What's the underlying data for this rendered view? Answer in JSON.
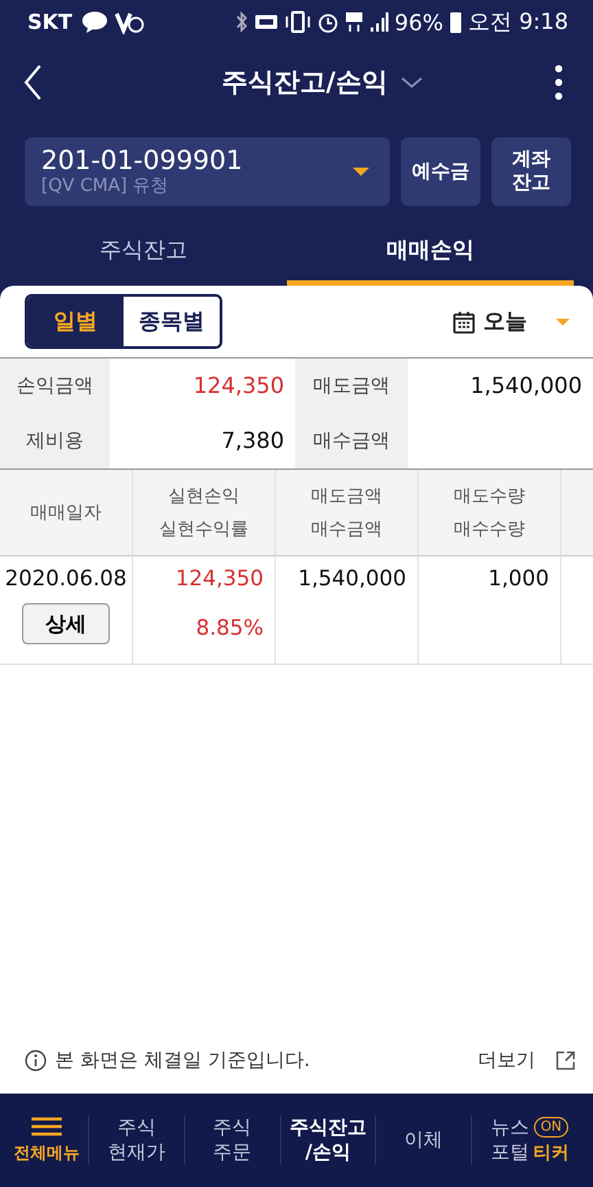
{
  "status_bar": {
    "carrier": "SKT",
    "battery": "96%",
    "time": "오전 9:18"
  },
  "header": {
    "title": "주식잔고/손익"
  },
  "account": {
    "number": "201-01-099901",
    "name": "[QV CMA] 유청",
    "buttons": [
      "예수금",
      "계좌\n잔고"
    ]
  },
  "tabs": [
    {
      "label": "주식잔고",
      "selected": false
    },
    {
      "label": "매매손익",
      "selected": true
    }
  ],
  "view_toggle": [
    {
      "label": "일별",
      "selected": true
    },
    {
      "label": "종목별",
      "selected": false
    }
  ],
  "period": {
    "value": "오늘"
  },
  "summary": [
    {
      "label": "손익금액",
      "value": "124,350",
      "gain": true
    },
    {
      "label": "매도금액",
      "value": "1,540,000",
      "gain": false
    },
    {
      "label": "제비용",
      "value": "7,380",
      "gain": false
    },
    {
      "label": "매수금액"
    }
  ],
  "table": {
    "columns": [
      [
        "매매일자"
      ],
      [
        "실현손익",
        "실현수익률"
      ],
      [
        "매도금액",
        "매수금액"
      ],
      [
        "매도수량",
        "매수수량"
      ]
    ],
    "rows": [
      {
        "date": "2020.06.08",
        "action": "상세",
        "realized": "124,350",
        "rate": "8.85%",
        "sell_amount": "1,540,000",
        "sell_qty": "1,000",
        "gain": true
      }
    ]
  },
  "footer": {
    "note": "본 화면은 체결일 기준입니다.",
    "more": "더보기"
  },
  "bottom_nav": [
    {
      "label": "전체메뉴",
      "kind": "menu",
      "selected": false
    },
    {
      "label": "주식\n현재가",
      "kind": "link",
      "selected": false
    },
    {
      "label": "주식\n주문",
      "kind": "link",
      "selected": false
    },
    {
      "label": "주식잔고\n/손익",
      "kind": "link",
      "selected": true
    },
    {
      "label": "이체",
      "kind": "link",
      "selected": false
    },
    {
      "label": "뉴스\n포털",
      "kind": "ticker",
      "badge": "ON",
      "extra": "티커",
      "selected": false
    }
  ]
}
